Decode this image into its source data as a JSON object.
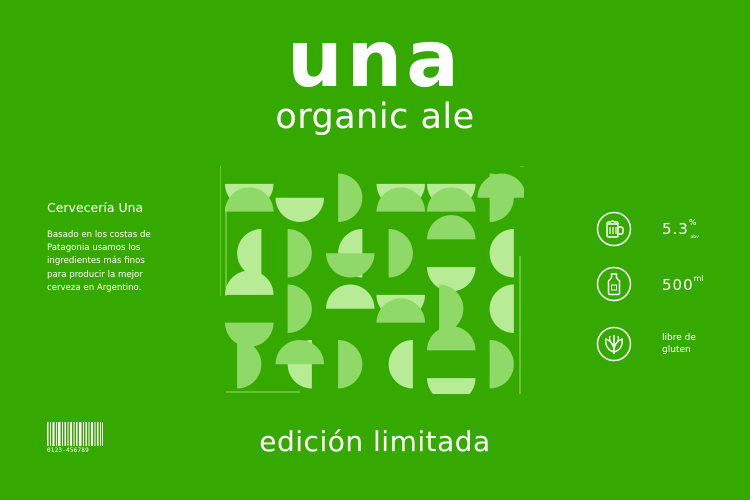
{
  "brand": {
    "name": "una",
    "subtitle": "organic ale"
  },
  "left": {
    "brewery": "Cervecería Una",
    "description": "Basado en los costas de Patagonia usamos los ingredientes más finos para producir la mejor cerveza en Argentino."
  },
  "barcode": {
    "number": "0123-456789"
  },
  "specs": {
    "abv": {
      "icon": "beer-mug-icon",
      "value": "5.3",
      "unit": "%",
      "unit_sub": "abv"
    },
    "volume": {
      "icon": "bottle-icon",
      "value": "500",
      "unit": "ml"
    },
    "gluten": {
      "icon": "wheat-icon",
      "line1": "libre de",
      "line2": "gluten"
    }
  },
  "footer": {
    "edition": "edición limitada"
  },
  "colors": {
    "background": "#35a900",
    "pattern_light": "#b8eb95",
    "pattern_dark": "#8fd968",
    "text": "#ffffff"
  }
}
